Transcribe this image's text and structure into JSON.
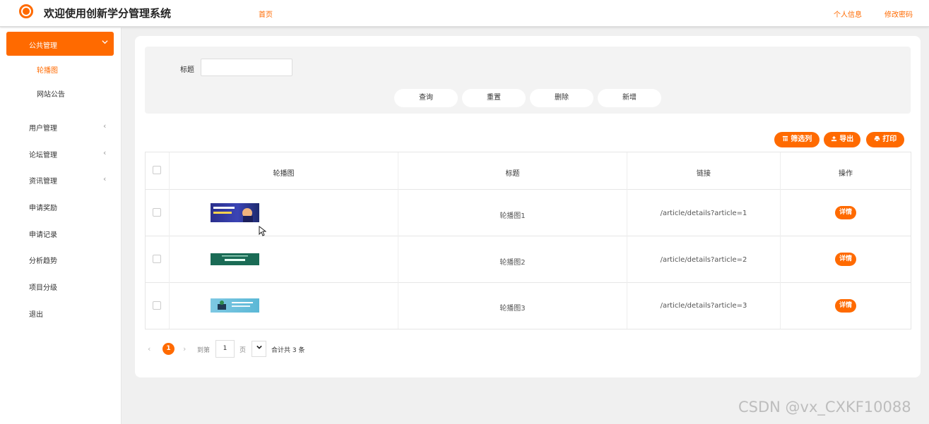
{
  "header": {
    "title": "欢迎使用创新学分管理系统",
    "home": "首页",
    "profile": "个人信息",
    "change_password": "修改密码"
  },
  "sidebar": {
    "active_group": "公共管理",
    "submenu": [
      "轮播图",
      "网站公告"
    ],
    "items": [
      "用户管理",
      "论坛管理",
      "资讯管理",
      "申请奖励",
      "申请记录",
      "分析趋势",
      "项目分级",
      "退出"
    ]
  },
  "search": {
    "label": "标题",
    "placeholder": "",
    "buttons": {
      "query": "查询",
      "reset": "重置",
      "delete": "删除",
      "add": "新增"
    }
  },
  "toolbar": {
    "filter": "筛选列",
    "export": "导出",
    "print": "打印"
  },
  "table": {
    "headers": [
      "轮播图",
      "标题",
      "链接",
      "操作"
    ],
    "rows": [
      {
        "title": "轮播图1",
        "link": "/article/details?article=1",
        "action": "详情"
      },
      {
        "title": "轮播图2",
        "link": "/article/details?article=2",
        "action": "详情"
      },
      {
        "title": "轮播图3",
        "link": "/article/details?article=3",
        "action": "详情"
      }
    ]
  },
  "pagination": {
    "current": "1",
    "goto": "到第",
    "page_input": "1",
    "page_unit": "页",
    "total": "合计共 3 条"
  },
  "watermark": "CSDN @vx_CXKF10088",
  "colors": {
    "accent": "#ff6a00"
  }
}
